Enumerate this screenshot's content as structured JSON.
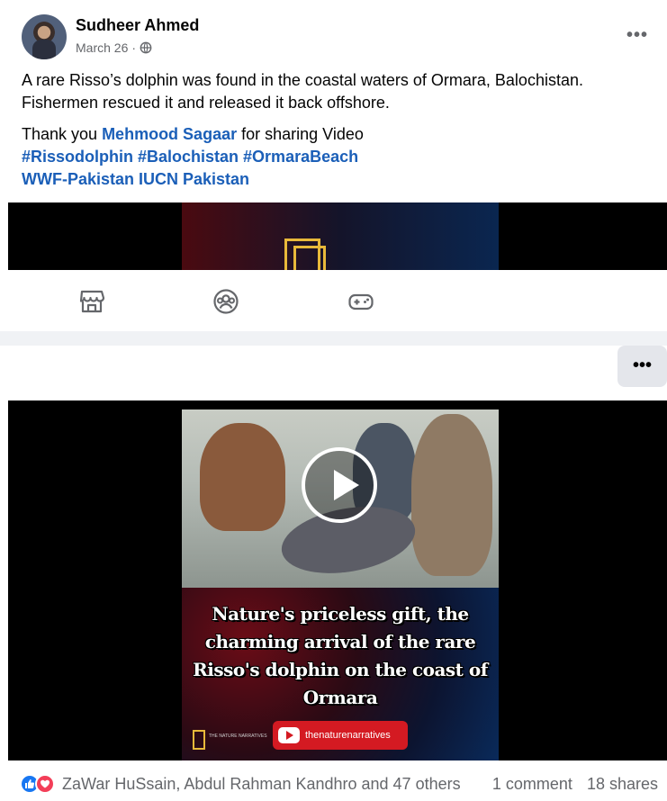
{
  "post": {
    "author": "Sudheer Ahmed",
    "date": "March 26",
    "date_separator": "·",
    "privacy_icon": "globe-icon",
    "more_label": "•••",
    "text_line1": "A rare Risso’s dolphin was found in the coastal waters of Ormara, Balochistan. Fishermen rescued it and released it back offshore.",
    "thanks_prefix": "Thank you ",
    "mention": "Mehmood Sagaar",
    "thanks_suffix": " for sharing Video",
    "hashtags": "#Rissodolphin #Balochistan #OrmaraBeach",
    "pages": "WWF-Pakistan IUCN Pakistan"
  },
  "nav": {
    "icons": [
      "marketplace-icon",
      "groups-icon",
      "gaming-icon"
    ]
  },
  "second": {
    "more_label": "•••",
    "video": {
      "caption": "Nature's priceless gift, the charming arrival of the rare Risso's dolphin on the coast of Ormara",
      "channel": "thenaturenarratives",
      "brand": "THE NATURE NARRATIVES"
    },
    "reactions": {
      "icons": [
        "like-icon",
        "love-icon"
      ],
      "names": "ZaWar HuSsain, Abdul Rahman Kandhro and 47 others",
      "comments": "1 comment",
      "shares": "18 shares"
    }
  },
  "colors": {
    "link": "#1b5fb8",
    "like": "#1877f2",
    "love": "#f33e58",
    "background": "#f0f2f5"
  }
}
